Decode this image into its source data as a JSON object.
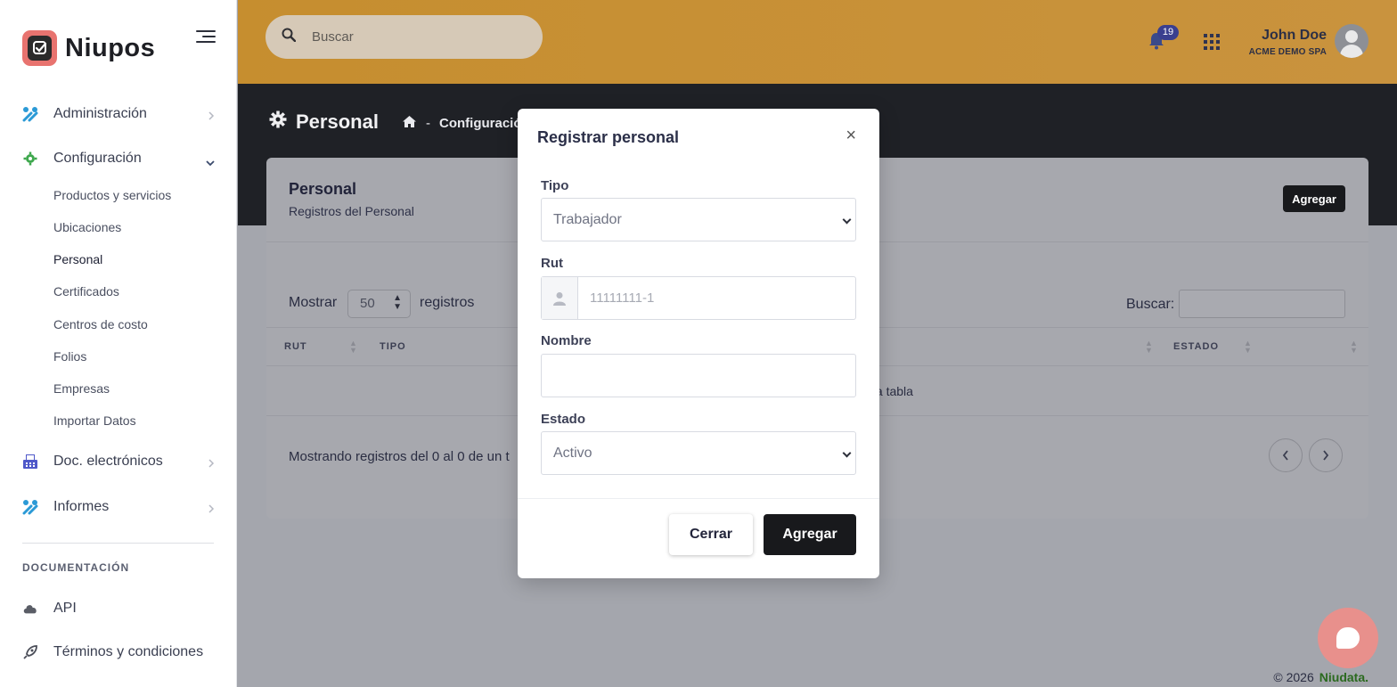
{
  "brand": {
    "name": "Niupos",
    "color": "#e8736f"
  },
  "sidebar": {
    "items": [
      {
        "label": "Administración",
        "icon": "tools-icon"
      },
      {
        "label": "Configuración",
        "icon": "gear-icon"
      },
      {
        "label": "Doc. electrónicos",
        "icon": "fax-icon"
      },
      {
        "label": "Informes",
        "icon": "tools-icon"
      }
    ],
    "config_sub": [
      "Productos y servicios",
      "Ubicaciones",
      "Personal",
      "Certificados",
      "Centros de costo",
      "Folios",
      "Empresas",
      "Importar Datos"
    ],
    "section_title": "DOCUMENTACIÓN",
    "doc_items": [
      {
        "label": "API",
        "icon": "cloud-icon"
      },
      {
        "label": "Términos y condiciones",
        "icon": "rocket-icon"
      }
    ]
  },
  "topbar": {
    "search_placeholder": "Buscar",
    "notifications": "19",
    "user_name": "John Doe",
    "user_company": "ACME DEMO SPA",
    "accent": "#c68e2f"
  },
  "page": {
    "title": "Personal",
    "breadcrumb": [
      "Configuració"
    ]
  },
  "card": {
    "title": "Personal",
    "subtitle": "Registros del Personal",
    "add_label": "Agregar",
    "show_label": "Mostrar",
    "show_value": "50",
    "show_after": "registros",
    "search_label": "Buscar:",
    "columns": [
      "RUT",
      "TIPO",
      "ESTADO"
    ],
    "empty_text": "ta tabla",
    "showing_text": "Mostrando registros del 0 al 0 de un t"
  },
  "modal": {
    "title": "Registrar personal",
    "close": "×",
    "tipo_label": "Tipo",
    "tipo_value": "Trabajador",
    "rut_label": "Rut",
    "rut_placeholder": "11111111-1",
    "nombre_label": "Nombre",
    "nombre_value": "",
    "estado_label": "Estado",
    "estado_value": "Activo",
    "cancel_label": "Cerrar",
    "submit_label": "Agregar"
  },
  "footer": {
    "copyright": "© 2026",
    "company": "Niudata."
  }
}
